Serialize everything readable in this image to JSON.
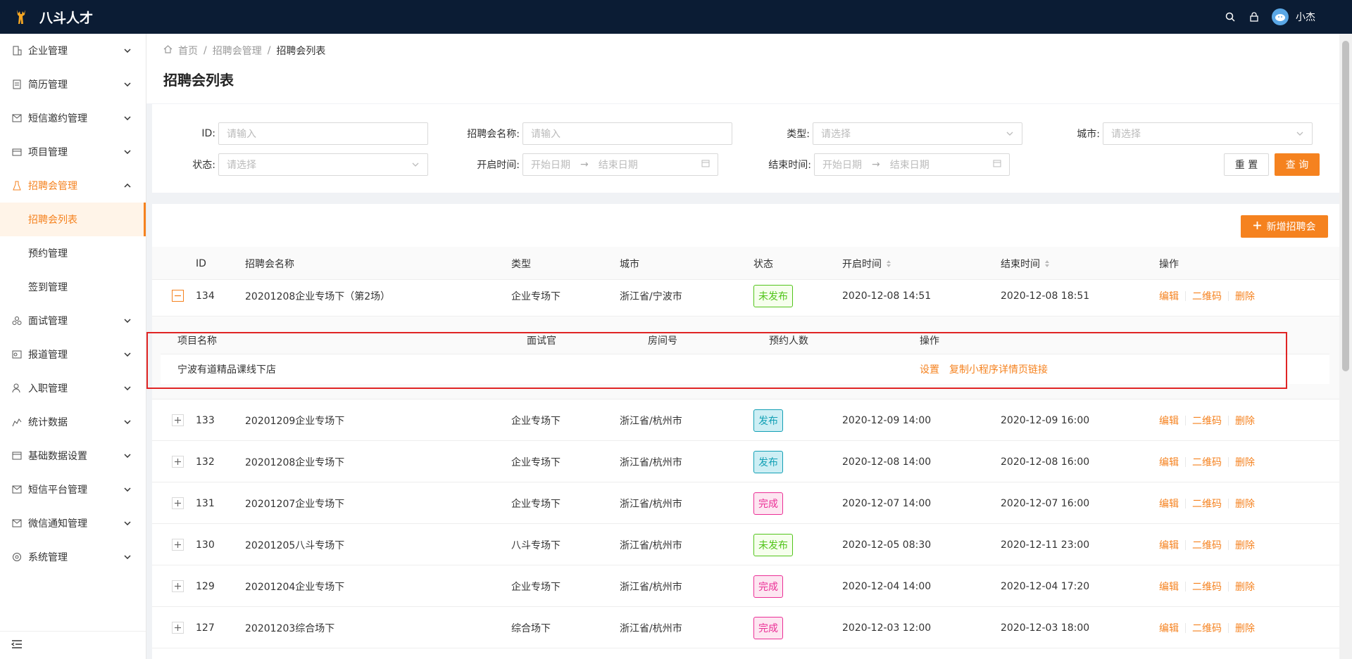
{
  "app": {
    "title": "八斗人才",
    "username": "小杰",
    "brand_color": "#f5821f",
    "topbar_color": "#0b1c34"
  },
  "sidebar": {
    "items": [
      {
        "label": "企业管理",
        "icon": "building-icon"
      },
      {
        "label": "简历管理",
        "icon": "document-icon"
      },
      {
        "label": "短信邀约管理",
        "icon": "mail-icon"
      },
      {
        "label": "项目管理",
        "icon": "folder-icon"
      },
      {
        "label": "招聘会管理",
        "icon": "flask-icon"
      },
      {
        "label": "面试管理",
        "icon": "cluster-icon"
      },
      {
        "label": "报道管理",
        "icon": "report-icon"
      },
      {
        "label": "入职管理",
        "icon": "user-icon"
      },
      {
        "label": "统计数据",
        "icon": "chart-icon"
      },
      {
        "label": "基础数据设置",
        "icon": "database-icon"
      },
      {
        "label": "短信平台管理",
        "icon": "mail-icon"
      },
      {
        "label": "微信通知管理",
        "icon": "mail-icon"
      },
      {
        "label": "系统管理",
        "icon": "gear-icon"
      }
    ],
    "sub": [
      "招聘会列表",
      "预约管理",
      "签到管理"
    ]
  },
  "breadcrumb": {
    "home": "首页",
    "parent": "招聘会管理",
    "current": "招聘会列表"
  },
  "page_title": "招聘会列表",
  "filters": {
    "id_label": "ID:",
    "id_placeholder": "请输入",
    "name_label": "招聘会名称:",
    "name_placeholder": "请输入",
    "type_label": "类型:",
    "type_placeholder": "请选择",
    "city_label": "城市:",
    "city_placeholder": "请选择",
    "status_label": "状态:",
    "status_placeholder": "请选择",
    "start_label": "开启时间:",
    "end_label": "结束时间:",
    "start_date": "开始日期",
    "end_date": "结束日期",
    "reset": "重 置",
    "query": "查 询"
  },
  "table": {
    "add_label": "新增招聘会",
    "headers": {
      "id": "ID",
      "name": "招聘会名称",
      "type": "类型",
      "city": "城市",
      "status": "状态",
      "start": "开启时间",
      "end": "结束时间",
      "ops": "操作"
    },
    "op_labels": {
      "edit": "编辑",
      "qr": "二维码",
      "delete": "删除"
    },
    "rows": [
      {
        "id": "134",
        "name": "20201208企业专场下（第2场）",
        "type": "企业专场下",
        "city": "浙江省/宁波市",
        "status": "未发布",
        "start": "2020-12-08 14:51",
        "end": "2020-12-08 18:51"
      },
      {
        "id": "133",
        "name": "20201209企业专场下",
        "type": "企业专场下",
        "city": "浙江省/杭州市",
        "status": "发布",
        "start": "2020-12-09 14:00",
        "end": "2020-12-09 16:00"
      },
      {
        "id": "132",
        "name": "20201208企业专场下",
        "type": "企业专场下",
        "city": "浙江省/杭州市",
        "status": "发布",
        "start": "2020-12-08 14:00",
        "end": "2020-12-08 16:00"
      },
      {
        "id": "131",
        "name": "20201207企业专场下",
        "type": "企业专场下",
        "city": "浙江省/杭州市",
        "status": "完成",
        "start": "2020-12-07 14:00",
        "end": "2020-12-07 16:00"
      },
      {
        "id": "130",
        "name": "20201205八斗专场下",
        "type": "八斗专场下",
        "city": "浙江省/杭州市",
        "status": "未发布",
        "start": "2020-12-05 08:30",
        "end": "2020-12-11 23:00"
      },
      {
        "id": "129",
        "name": "20201204企业专场下",
        "type": "企业专场下",
        "city": "浙江省/杭州市",
        "status": "完成",
        "start": "2020-12-04 14:00",
        "end": "2020-12-04 17:20"
      },
      {
        "id": "127",
        "name": "20201203综合场下",
        "type": "综合场下",
        "city": "浙江省/杭州市",
        "status": "完成",
        "start": "2020-12-03 12:00",
        "end": "2020-12-03 18:00"
      }
    ],
    "expanded": {
      "headers": {
        "project": "项目名称",
        "interviewer": "面试官",
        "room": "房间号",
        "count": "预约人数",
        "ops": "操作"
      },
      "row": {
        "project": "宁波有道精品课线下店",
        "interviewer": "",
        "room": "",
        "count": "",
        "op_settings": "设置",
        "op_copy": "复制小程序详情页链接"
      }
    }
  }
}
